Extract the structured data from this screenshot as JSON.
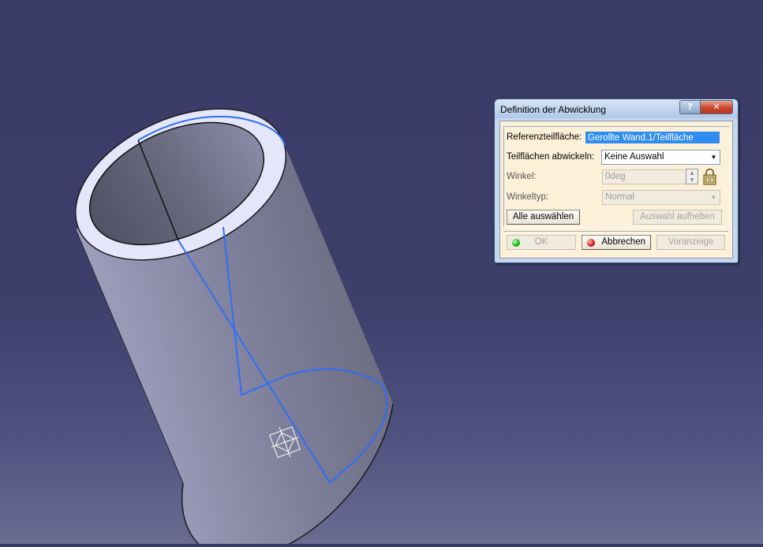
{
  "dialog": {
    "title": "Definition der Abwicklung",
    "help_glyph": "?",
    "close_glyph": "✕",
    "fields": {
      "reference_label": "Referenzteilfläche:",
      "reference_value": "Gerollte Wand.1/Teilfläche",
      "unfold_label": "Teilflächen abwickeln:",
      "unfold_value": "Keine Auswahl",
      "angle_label": "Winkel:",
      "angle_value": "0deg",
      "angle_type_label": "Winkeltyp:",
      "angle_type_value": "Normal"
    },
    "buttons": {
      "select_all": "Alle auswählen",
      "deselect": "Auswahl aufheben",
      "ok": "OK",
      "cancel": "Abbrechen",
      "preview": "Voranzeige"
    }
  },
  "viewport": {
    "model": "rolled-wall-cylinder",
    "colors": {
      "background_top": "#3a3b66",
      "selection_edge": "#2f6ef5",
      "cylinder_face": "#8a8ba8",
      "rim_face": "#e6e6fa"
    }
  },
  "icons": {
    "ok": "green-status-dot-icon",
    "cancel": "red-status-dot-icon",
    "formula": "formula-lock-icon",
    "compass": "axis-compass-icon"
  }
}
